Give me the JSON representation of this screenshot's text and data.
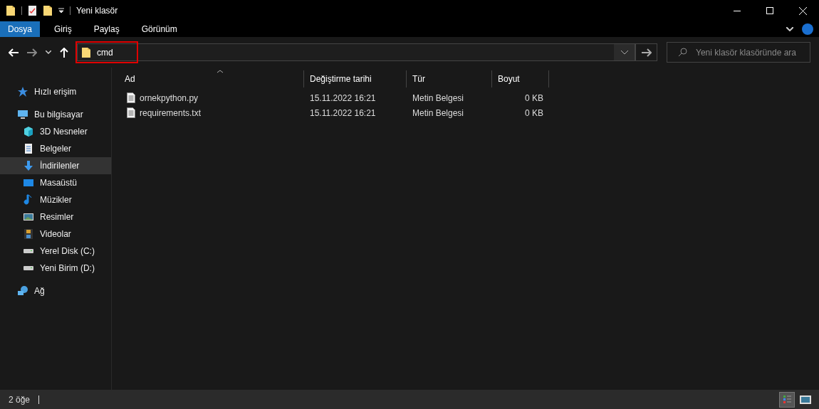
{
  "window": {
    "title": "Yeni klasör"
  },
  "ribbon_tabs": [
    {
      "label": "Dosya",
      "selected": true
    },
    {
      "label": "Giriş",
      "selected": false
    },
    {
      "label": "Paylaş",
      "selected": false
    },
    {
      "label": "Görünüm",
      "selected": false
    }
  ],
  "address": {
    "value": "cmd",
    "highlighted": true
  },
  "search": {
    "placeholder": "Yeni klasör klasöründe ara"
  },
  "sidebar": {
    "items": [
      {
        "label": "Hızlı erişim",
        "kind": "star",
        "selected": false
      },
      {
        "label": "Bu bilgisayar",
        "kind": "computer",
        "selected": false,
        "children": [
          {
            "label": "3D Nesneler",
            "kind": "cube",
            "selected": false
          },
          {
            "label": "Belgeler",
            "kind": "document",
            "selected": false
          },
          {
            "label": "İndirilenler",
            "kind": "download",
            "selected": true
          },
          {
            "label": "Masaüstü",
            "kind": "desktop",
            "selected": false
          },
          {
            "label": "Müzikler",
            "kind": "music",
            "selected": false
          },
          {
            "label": "Resimler",
            "kind": "image",
            "selected": false
          },
          {
            "label": "Videolar",
            "kind": "video",
            "selected": false
          },
          {
            "label": "Yerel Disk (C:)",
            "kind": "drive",
            "selected": false
          },
          {
            "label": "Yeni Birim (D:)",
            "kind": "drive",
            "selected": false
          }
        ]
      },
      {
        "label": "Ağ",
        "kind": "network",
        "selected": false
      }
    ]
  },
  "table": {
    "columns": [
      "Ad",
      "Değiştirme tarihi",
      "Tür",
      "Boyut"
    ],
    "rows": [
      [
        "ornekpython.py",
        "15.11.2022 16:21",
        "Metin Belgesi",
        "0 KB"
      ],
      [
        "requirements.txt",
        "15.11.2022 16:21",
        "Metin Belgesi",
        "0 KB"
      ]
    ]
  },
  "status_bar": {
    "count": "2 öğe",
    "view_buttons": [
      {
        "kind": "details",
        "selected": true
      },
      {
        "kind": "icons",
        "selected": false
      }
    ]
  }
}
